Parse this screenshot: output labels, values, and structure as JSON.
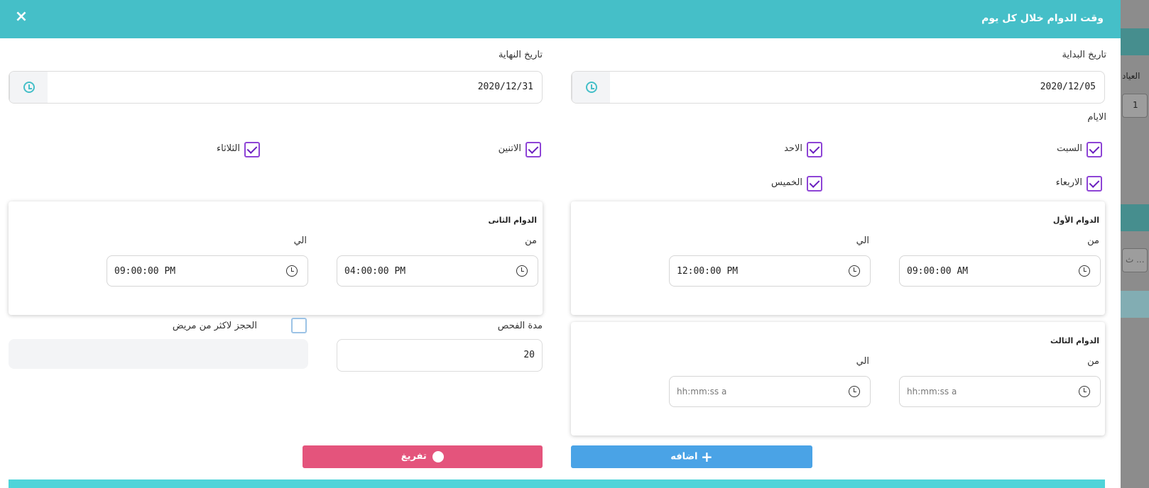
{
  "modal": {
    "title": "وقت الدوام خلال كل يوم",
    "close_label": "×"
  },
  "dates": {
    "start_label": "تاريخ البداية",
    "start_value": "2020/12/05",
    "end_label": "تاريخ النهاية",
    "end_value": "2020/12/31"
  },
  "days": {
    "label": "الايام",
    "items": [
      {
        "label": "السبت",
        "checked": true
      },
      {
        "label": "الاحد",
        "checked": true
      },
      {
        "label": "الاتنين",
        "checked": true
      },
      {
        "label": "الثلاثاء",
        "checked": true
      },
      {
        "label": "الاربعاء",
        "checked": true
      },
      {
        "label": "الخميس",
        "checked": true
      }
    ]
  },
  "shifts": {
    "first": {
      "title": "الدوام الأول",
      "from_label": "من",
      "to_label": "الي",
      "from_value": "09:00:00 AM",
      "to_value": "12:00:00 PM"
    },
    "second": {
      "title": "الدوام الثانى",
      "from_label": "من",
      "to_label": "الي",
      "from_value": "04:00:00 PM",
      "to_value": "09:00:00 PM"
    },
    "third": {
      "title": "الدوام الثالث",
      "from_label": "من",
      "to_label": "الي",
      "from_placeholder": "hh:mm:ss a",
      "to_placeholder": "hh:mm:ss a"
    }
  },
  "exam": {
    "duration_label": "مدة الفحص",
    "duration_value": "20"
  },
  "multi_booking": {
    "label": "الحجز لاكثر من مريض",
    "checked": false
  },
  "buttons": {
    "add_label": "اضافه",
    "clear_label": "تفريغ"
  },
  "background": {
    "side_text_1": "العياد",
    "side_value": "1",
    "side_text_2": "ث ..."
  },
  "colors": {
    "header": "#45bfc8",
    "add": "#4aa3e6",
    "clear": "#e4547c",
    "checkbox": "#8e44d6"
  }
}
